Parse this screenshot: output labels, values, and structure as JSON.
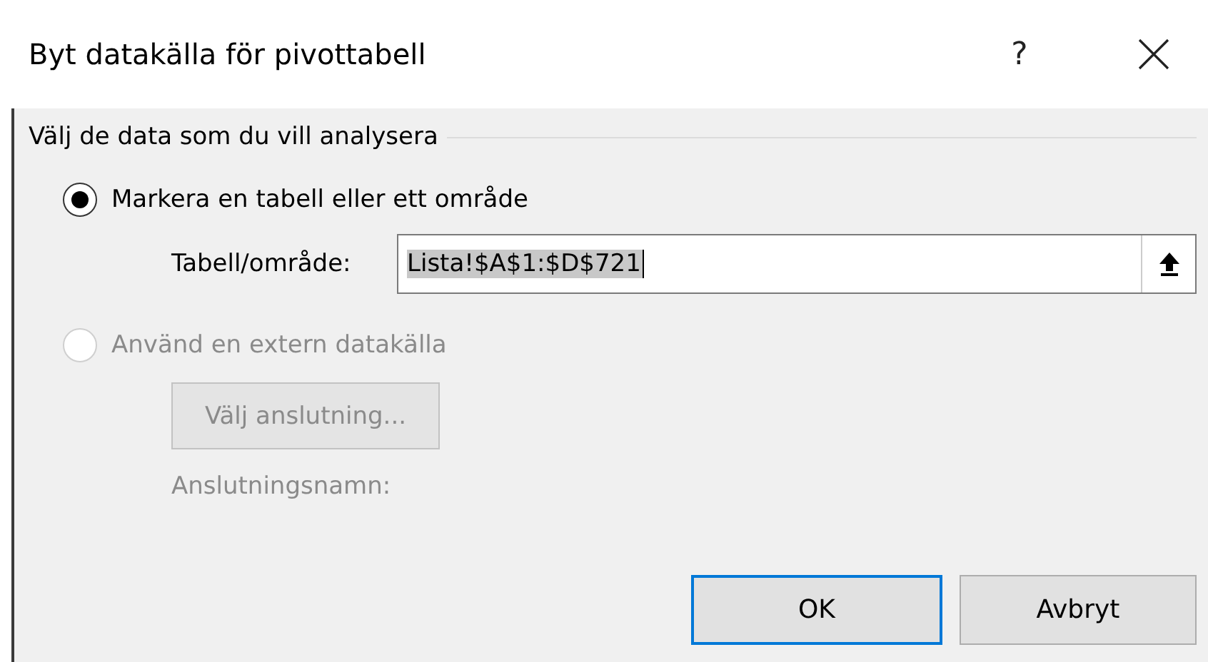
{
  "window": {
    "title": "Byt datakälla för pivottabell",
    "help": "?"
  },
  "group": {
    "label": "Välj de data som du vill analysera"
  },
  "options": [
    {
      "kind": "range",
      "label": "Markera en tabell eller ett område",
      "selected": true,
      "disabled": false,
      "field_label": "Tabell/område:",
      "value": "Lista!$A$1:$D$721"
    },
    {
      "kind": "external",
      "label": "Använd en extern datakälla",
      "selected": false,
      "disabled": true,
      "button": "Välj anslutning...",
      "name_label": "Anslutningsnamn:"
    }
  ],
  "buttons": [
    {
      "label": "OK",
      "default": true
    },
    {
      "label": "Avbryt",
      "default": false
    }
  ]
}
